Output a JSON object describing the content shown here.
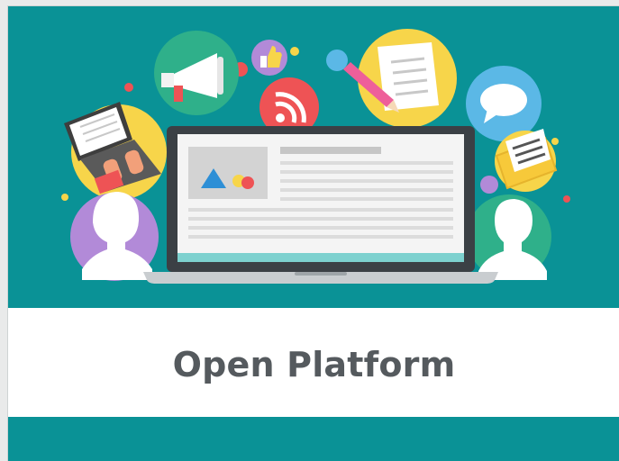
{
  "title": "Open Platform",
  "colors": {
    "background_teal": "#0a9296",
    "band_white": "#ffffff",
    "title_gray": "#555a5e",
    "accent_yellow": "#f7d54a",
    "accent_green": "#2fb08a",
    "accent_blue": "#5bb8e6",
    "accent_red": "#ee5355",
    "accent_purple": "#b28ad8"
  },
  "illustration": {
    "icons": [
      "megaphone-icon",
      "thumbs-up-icon",
      "wifi-icon",
      "document-pencil-icon",
      "chat-bubble-icon",
      "laptop-typing-icon",
      "envelope-icon",
      "user-female-icon",
      "user-male-icon",
      "laptop-screen-icon"
    ]
  }
}
